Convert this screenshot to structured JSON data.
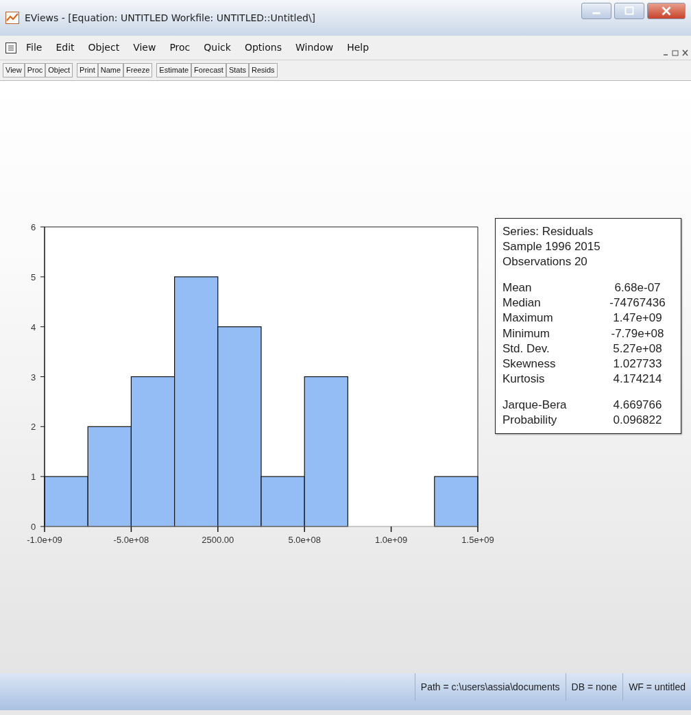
{
  "window": {
    "title": "EViews - [Equation: UNTITLED   Workfile: UNTITLED::Untitled\\]"
  },
  "menu": [
    "File",
    "Edit",
    "Object",
    "View",
    "Proc",
    "Quick",
    "Options",
    "Window",
    "Help"
  ],
  "toolbar": [
    {
      "label": "View",
      "group_start": false
    },
    {
      "label": "Proc",
      "group_start": false
    },
    {
      "label": "Object",
      "group_start": false
    },
    {
      "label": "Print",
      "group_start": true
    },
    {
      "label": "Name",
      "group_start": false
    },
    {
      "label": "Freeze",
      "group_start": false
    },
    {
      "label": "Estimate",
      "group_start": true
    },
    {
      "label": "Forecast",
      "group_start": false
    },
    {
      "label": "Stats",
      "group_start": false
    },
    {
      "label": "Resids",
      "group_start": false
    }
  ],
  "histogram": {
    "chart_data": {
      "type": "bar",
      "x": [
        -875000000,
        -625000000,
        -375000000,
        -125000000,
        125000000,
        375000000,
        625000000,
        1375000000
      ],
      "values": [
        1,
        2,
        3,
        5,
        4,
        1,
        3,
        1
      ],
      "xlim": [
        -1000000000,
        1500000000
      ],
      "ylim": [
        0,
        6
      ],
      "xticks": [
        {
          "value": -1000000000,
          "label": "-1.0e+09"
        },
        {
          "value": -500000000,
          "label": "-5.0e+08"
        },
        {
          "value": 2500,
          "label": "2500.00"
        },
        {
          "value": 500000000,
          "label": "5.0e+08"
        },
        {
          "value": 1000000000,
          "label": "1.0e+09"
        },
        {
          "value": 1500000000,
          "label": "1.5e+09"
        }
      ],
      "yticks": [
        0,
        1,
        2,
        3,
        4,
        5,
        6
      ]
    }
  },
  "stats": {
    "header": [
      "Series: Residuals",
      "Sample 1996 2015",
      "Observations 20"
    ],
    "groups": [
      [
        {
          "label": "Mean",
          "value": "6.68e-07"
        },
        {
          "label": "Median",
          "value": "-74767436"
        },
        {
          "label": "Maximum",
          "value": "1.47e+09"
        },
        {
          "label": "Minimum",
          "value": "-7.79e+08"
        },
        {
          "label": "Std. Dev.",
          "value": "5.27e+08"
        },
        {
          "label": "Skewness",
          "value": "1.027733"
        },
        {
          "label": "Kurtosis",
          "value": "4.174214"
        }
      ],
      [
        {
          "label": "Jarque-Bera",
          "value": "4.669766"
        },
        {
          "label": "Probability",
          "value": "0.096822"
        }
      ]
    ]
  },
  "status_bar": [
    "Path = c:\\users\\assia\\documents",
    "DB = none",
    "WF = untitled"
  ]
}
